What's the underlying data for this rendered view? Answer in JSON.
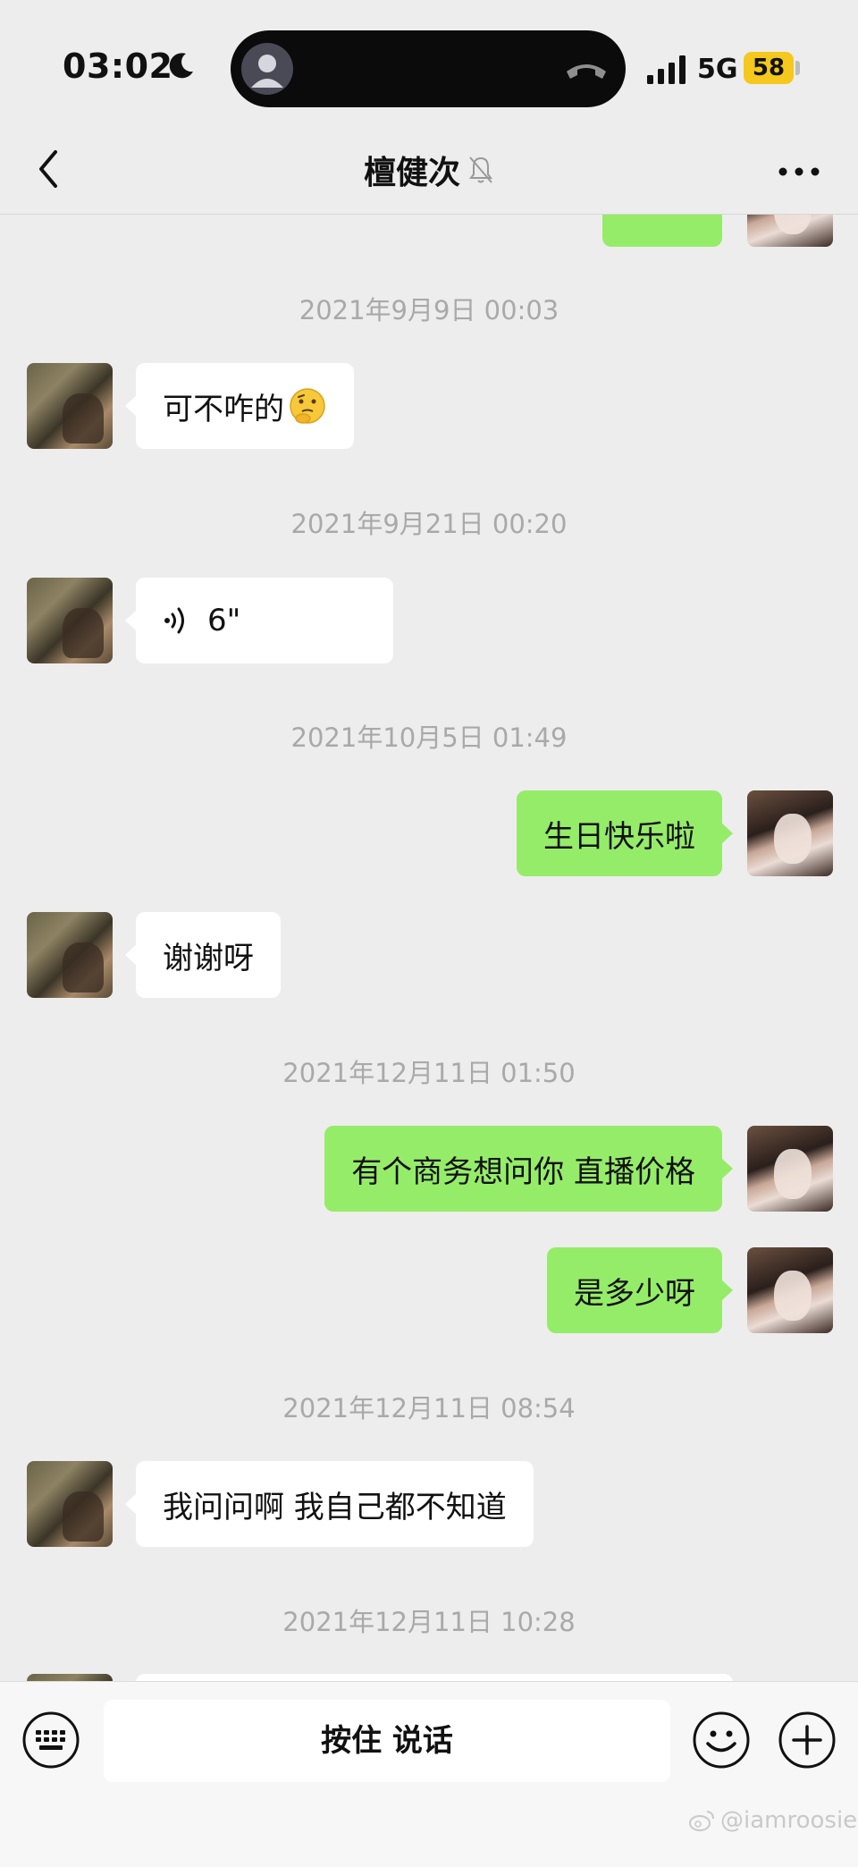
{
  "status_bar": {
    "time": "03:02",
    "network": "5G",
    "battery": "58"
  },
  "nav": {
    "title": "檀健次"
  },
  "messages": [
    {
      "type": "timestamp",
      "text": "2021年9月9日 00:03"
    },
    {
      "type": "in",
      "text": "可不咋的"
    },
    {
      "type": "timestamp",
      "text": "2021年9月21日 00:20"
    },
    {
      "type": "voice",
      "duration": "6\""
    },
    {
      "type": "timestamp",
      "text": "2021年10月5日 01:49"
    },
    {
      "type": "out",
      "text": "生日快乐啦"
    },
    {
      "type": "in",
      "text": "谢谢呀"
    },
    {
      "type": "timestamp",
      "text": "2021年12月11日 01:50"
    },
    {
      "type": "out",
      "text": "有个商务想问你 直播价格"
    },
    {
      "type": "out",
      "text": "是多少呀"
    },
    {
      "type": "timestamp",
      "text": "2021年12月11日 08:54"
    },
    {
      "type": "in",
      "text": "我问问啊 我自己都不知道"
    },
    {
      "type": "timestamp",
      "text": "2021年12月11日 10:28"
    }
  ],
  "input_bar": {
    "hold_to_talk": "按住 说话"
  },
  "watermark": "@iamroosie",
  "colors": {
    "background": "#ededed",
    "outgoing_bubble": "#95ec69",
    "incoming_bubble": "#ffffff",
    "battery": "#f4c81c"
  },
  "icons": [
    "moon-icon",
    "signal-icon",
    "hangup-icon",
    "back-chevron-icon",
    "mute-bell-icon",
    "more-icon",
    "voice-wave-icon",
    "keyboard-icon",
    "emoji-icon",
    "plus-icon",
    "weibo-icon"
  ]
}
